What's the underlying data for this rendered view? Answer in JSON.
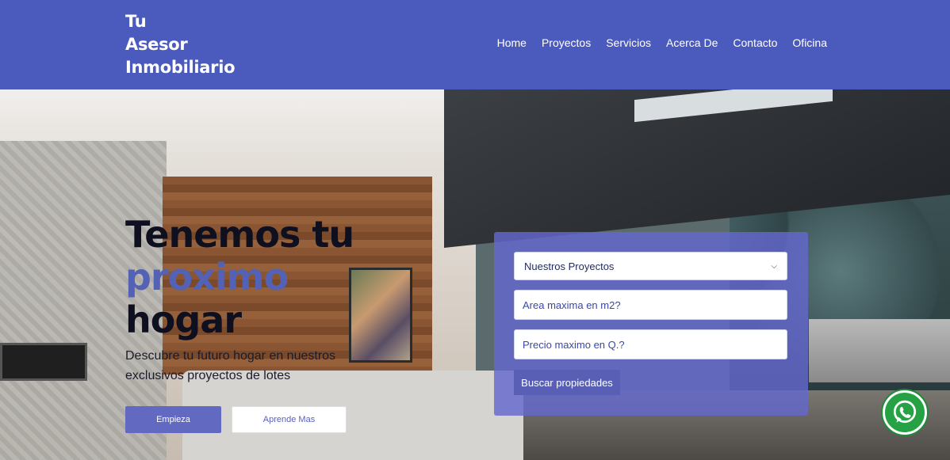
{
  "header": {
    "logo_lines": [
      "Tu",
      "Asesor",
      "Inmobiliario"
    ],
    "nav": [
      "Home",
      "Proyectos",
      "Servicios",
      "Acerca De",
      "Contacto",
      "Oficina"
    ]
  },
  "hero": {
    "title_lines": [
      "Tenemos tu",
      "proximo",
      "hogar"
    ],
    "subtitle": "Descubre tu futuro hogar en nuestros exclusivos proyectos de lotes",
    "primary_button": "Empieza",
    "secondary_button": "Aprende Mas"
  },
  "search": {
    "select_value": "Nuestros Proyectos",
    "area_placeholder": "Area maxima en m2?",
    "price_placeholder": "Precio maximo en Q.?",
    "submit_label": "Buscar propiedades"
  },
  "colors": {
    "header_bg": "#4b5bbd",
    "accent": "#5462b5",
    "whatsapp": "#25a244"
  },
  "icons": {
    "whatsapp": "whatsapp-icon",
    "select_chevron": "chevron-down-icon"
  }
}
